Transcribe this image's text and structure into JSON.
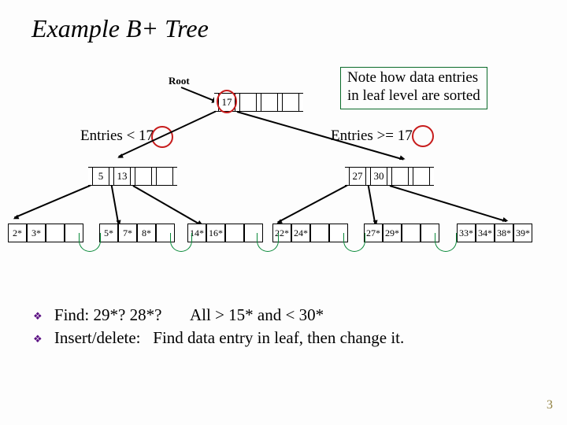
{
  "title": "Example B+ Tree",
  "root_label": "Root",
  "callout_line1": "Note how data entries",
  "callout_line2": "in leaf level are sorted",
  "split_left": "Entries <  17",
  "split_right": "Entries >=  17",
  "root_node": {
    "v0": "17"
  },
  "inner_left": {
    "v0": "5",
    "v1": "13"
  },
  "inner_right": {
    "v0": "27",
    "v1": "30"
  },
  "leaves": {
    "l0": {
      "c0": "2*",
      "c1": "3*"
    },
    "l1": {
      "c0": "5*",
      "c1": "7*",
      "c2": "8*"
    },
    "l2": {
      "c0": "14*",
      "c1": "16*"
    },
    "l3": {
      "c0": "22*",
      "c1": "24*"
    },
    "l4": {
      "c0": "27*",
      "c1": "29*"
    },
    "l5": {
      "c0": "33*",
      "c1": "34*",
      "c2": "38*",
      "c3": "39*"
    }
  },
  "bullets": {
    "b1a": "Find:   29*?     28*?",
    "b1b": "All > 15* and < 30*",
    "b2a": "Insert/delete:",
    "b2b": "Find data entry in leaf, then change it."
  },
  "page_number": "3",
  "chart_data": {
    "type": "table",
    "tree_type": "B+ tree",
    "root": [
      17
    ],
    "internal_nodes": [
      {
        "keys": [
          5,
          13
        ],
        "range": "< 17"
      },
      {
        "keys": [
          27,
          30
        ],
        "range": ">= 17"
      }
    ],
    "leaf_nodes": [
      [
        2,
        3
      ],
      [
        5,
        7,
        8
      ],
      [
        14,
        16
      ],
      [
        22,
        24
      ],
      [
        27,
        29
      ],
      [
        33,
        34,
        38,
        39
      ]
    ],
    "leaf_capacity": 4,
    "internal_capacity_shown": 4,
    "highlighted_values": [
      17,
      17,
      17
    ]
  }
}
